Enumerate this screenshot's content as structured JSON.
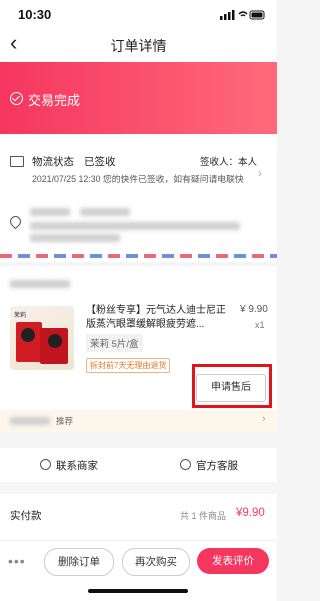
{
  "status_bar": {
    "time": "10:30"
  },
  "header": {
    "back_icon": "chevron-left-icon",
    "title": "订单详情"
  },
  "banner": {
    "status": "交易完成",
    "color": "#f5365f"
  },
  "shipping": {
    "label": "物流状态",
    "status": "已签收",
    "signer": "签收人：本人",
    "detail": "2021/07/25 12:30 您的快件已签收，如有疑问请电联快"
  },
  "product": {
    "title": "【粉丝专享】元气达人迪士尼正版蒸汽眼罩缓解眼疲劳遮...",
    "price": "¥ 9.90",
    "quantity": "x1",
    "sku": "茉莉 5片/盒",
    "return_badge": "拆封前7天无理由退货",
    "apply_button": "申请售后",
    "image_label": "茉莉"
  },
  "recommend": {
    "label": "推荐"
  },
  "contact": {
    "merchant": "联系商家",
    "service": "官方客服"
  },
  "payment": {
    "label": "实付款",
    "count": "共 1 件商品",
    "total": "¥9.90"
  },
  "actions": {
    "delete": "删除订单",
    "rebuy": "再次购买",
    "review": "发表评价",
    "more": "•••"
  },
  "colors": {
    "accent": "#f5365f",
    "highlight": "#e3131b"
  }
}
